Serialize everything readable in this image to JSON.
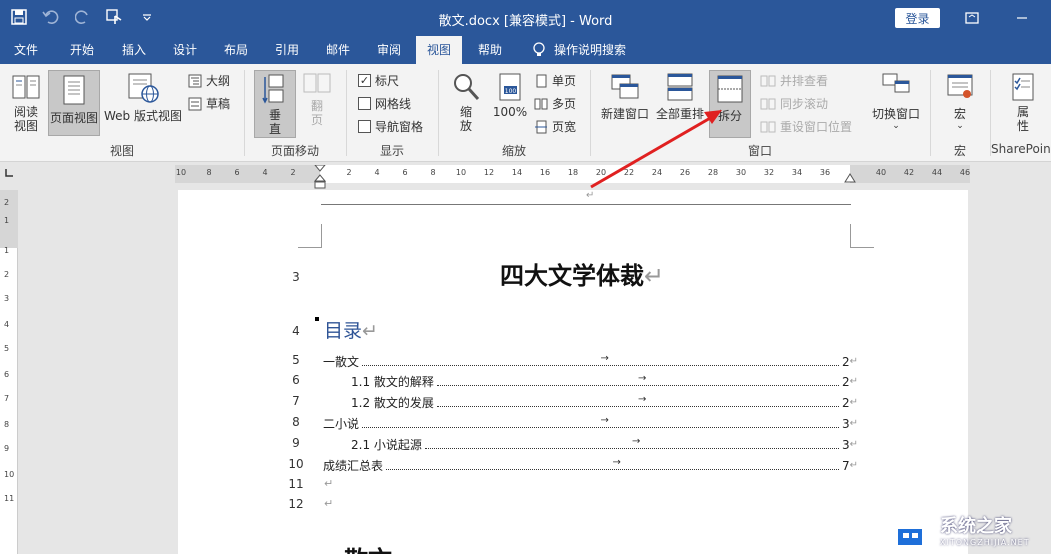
{
  "title_bar": {
    "doc_title": "散文.docx [兼容模式] - Word",
    "login": "登录"
  },
  "tabs": [
    {
      "label": "文件"
    },
    {
      "label": "开始"
    },
    {
      "label": "插入"
    },
    {
      "label": "设计"
    },
    {
      "label": "布局"
    },
    {
      "label": "引用"
    },
    {
      "label": "邮件"
    },
    {
      "label": "审阅"
    },
    {
      "label": "视图"
    },
    {
      "label": "帮助"
    }
  ],
  "active_tab": "视图",
  "tell_me": "操作说明搜索",
  "ribbon": {
    "views": {
      "read_mode": "阅读\n视图",
      "print_layout": "页面视图",
      "web_layout": "Web 版式视图",
      "outline": "大纲",
      "draft": "草稿",
      "group": "视图"
    },
    "page_movement": {
      "vertical": "垂直",
      "side_by_side": "翻页",
      "group": "页面移动"
    },
    "show": {
      "ruler": "标尺",
      "ruler_checked": true,
      "gridlines": "网格线",
      "nav_pane": "导航窗格",
      "group": "显示"
    },
    "zoom": {
      "zoom": "缩放",
      "hundred": "100%",
      "one_page": "单页",
      "multi_page": "多页",
      "page_width": "页宽",
      "group": "缩放"
    },
    "window": {
      "new_window": "新建窗口",
      "arrange_all": "全部重排",
      "split": "拆分",
      "side_by_side": "并排查看",
      "sync_scroll": "同步滚动",
      "reset_position": "重设窗口位置",
      "switch_windows": "切换窗口",
      "group": "窗口"
    },
    "macros": {
      "macros": "宏",
      "group": "宏"
    },
    "sharepoint": {
      "properties": "属\n性",
      "group": "SharePoint"
    }
  },
  "ruler": {
    "labels": [
      "10",
      "8",
      "6",
      "4",
      "2",
      "2",
      "4",
      "6",
      "8",
      "10",
      "12",
      "14",
      "16",
      "18",
      "20",
      "22",
      "24",
      "26",
      "28",
      "30",
      "32",
      "34",
      "36",
      "40",
      "42",
      "44",
      "46"
    ]
  },
  "vruler": {
    "labels": [
      "2",
      "1",
      "1",
      "2",
      "3",
      "4",
      "5",
      "6",
      "7",
      "8",
      "9",
      "10",
      "11"
    ]
  },
  "document": {
    "heading": "四大文学体裁",
    "toc_title": "目录",
    "pilcrow": "↵",
    "tab_mark": "→",
    "toc": [
      {
        "line": "5",
        "text": "一散文",
        "page": "2",
        "indent": 0
      },
      {
        "line": "6",
        "text": "1.1 散文的解释",
        "page": "2",
        "indent": 1
      },
      {
        "line": "7",
        "text": "1.2 散文的发展",
        "page": "2",
        "indent": 1
      },
      {
        "line": "8",
        "text": "二小说",
        "page": "3",
        "indent": 0
      },
      {
        "line": "9",
        "text": "2.1 小说起源",
        "page": "3",
        "indent": 1
      },
      {
        "line": "10",
        "text": "成绩汇总表",
        "page": "7",
        "indent": 0
      }
    ],
    "line_numbers": {
      "heading": "3",
      "toc_title": "4",
      "empty1": "11",
      "empty2": "12"
    },
    "next_heading": "散文"
  },
  "watermark": {
    "name": "系统之家",
    "url": "XITONGZHIJIA.NET"
  },
  "colors": {
    "brand": "#2b579a",
    "annotation_arrow": "#e02020"
  }
}
